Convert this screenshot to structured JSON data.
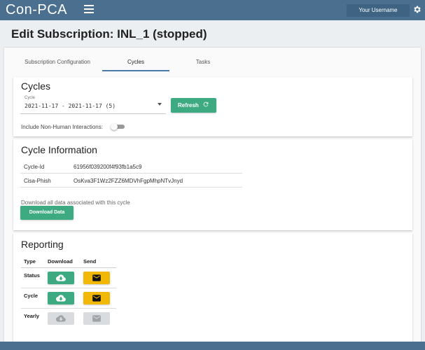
{
  "header": {
    "logo": "Con-PCA",
    "username": "Your Username"
  },
  "page": {
    "title": "Edit Subscription: INL_1 (stopped)"
  },
  "tabs": [
    {
      "label": "Subscription Configuration",
      "active": false
    },
    {
      "label": "Cycles",
      "active": true
    },
    {
      "label": "Tasks",
      "active": false
    }
  ],
  "cycles": {
    "heading": "Cycles",
    "select_label": "Cycle",
    "select_value": "2021-11-17 - 2021-11-17 (5)",
    "refresh_label": "Refresh",
    "toggle_label": "Include Non-Human Interactions:",
    "toggle_on": false
  },
  "cycle_info": {
    "heading": "Cycle Information",
    "rows": [
      {
        "key": "Cycle-Id",
        "value": "61956f039200f4f93fb1a5c9"
      },
      {
        "key": "Cisa-Phish",
        "value": "OsKva3F1Wz2FZZ6MDVhFgpMhpNTvJnyd"
      }
    ],
    "download_text": "Download all data associated with this cycle",
    "download_button": "Download Data"
  },
  "reporting": {
    "heading": "Reporting",
    "columns": [
      "Type",
      "Download",
      "Send"
    ],
    "rows": [
      {
        "type": "Status",
        "enabled": true
      },
      {
        "type": "Cycle",
        "enabled": true
      },
      {
        "type": "Yearly",
        "enabled": false
      }
    ]
  },
  "colors": {
    "header": "#4a6f8f",
    "primary_green": "#3daa82",
    "send_yellow": "#f2b807",
    "disabled": "#d9dcdf"
  }
}
